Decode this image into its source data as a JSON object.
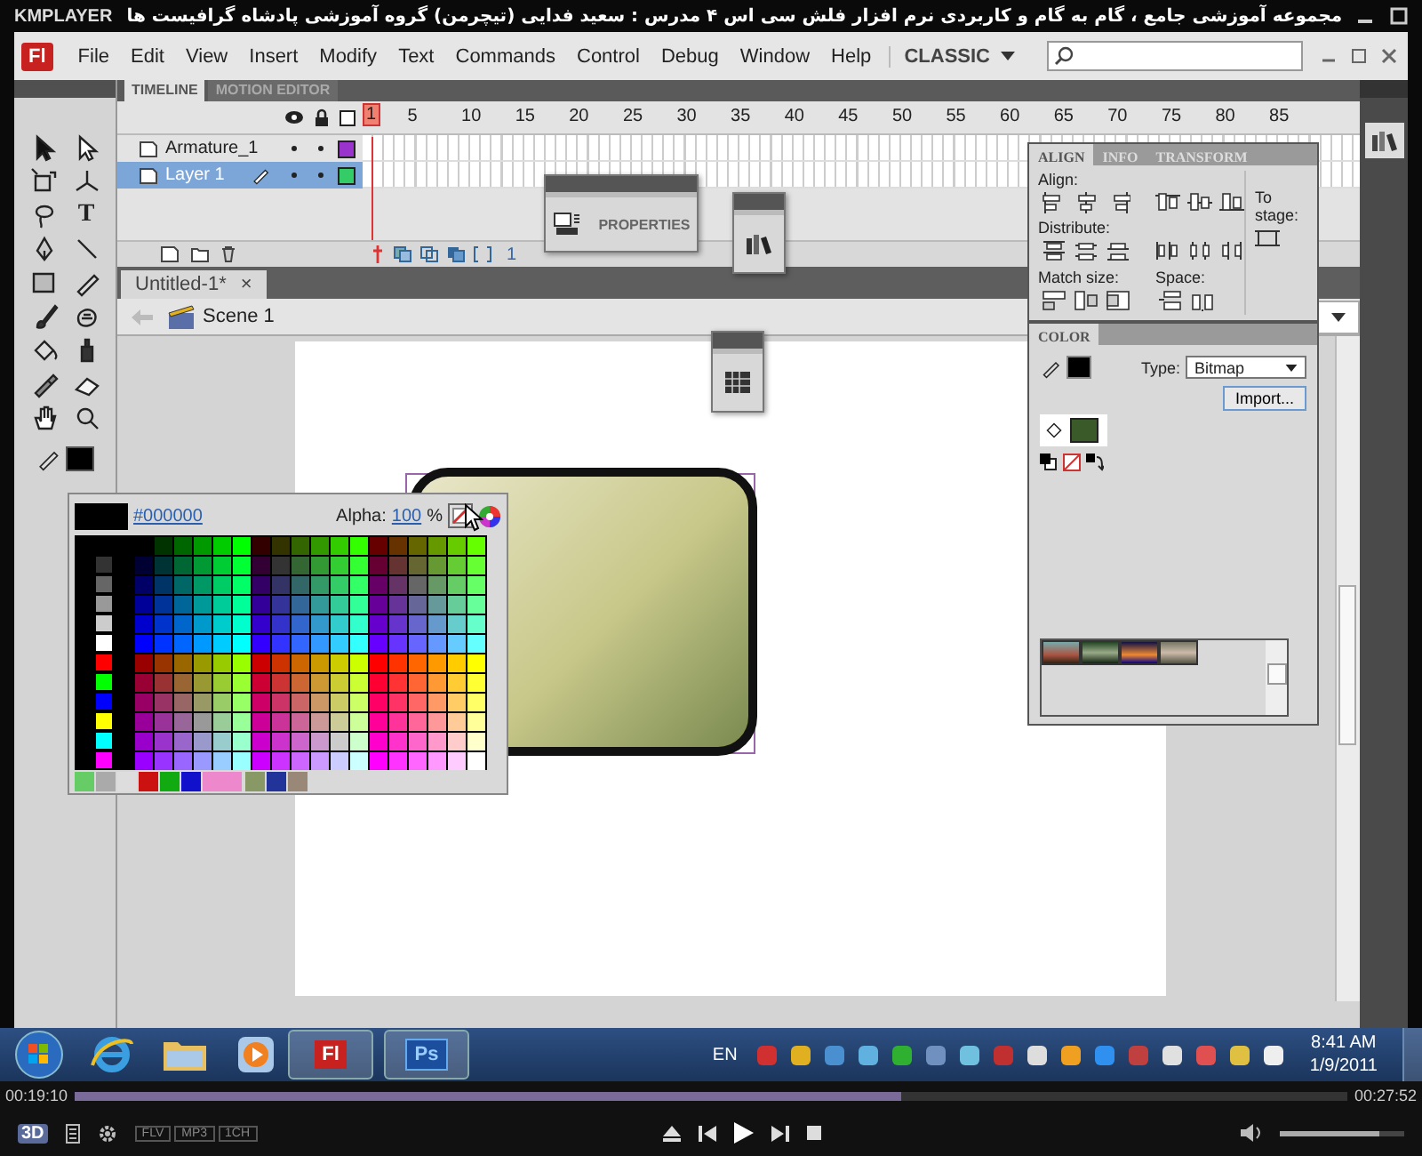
{
  "player": {
    "logo": "KMPLAYER",
    "title": "مجموعه آموزشی جامع ، گام به گام و کاربردی نرم افزار فلش سی اس ۴ مدرس : سعید فدایی (تیچرمن) گروه آموزشی پادشاه گرافیست ها"
  },
  "app": {
    "logo": "Fl",
    "menu": [
      "File",
      "Edit",
      "View",
      "Insert",
      "Modify",
      "Text",
      "Commands",
      "Control",
      "Debug",
      "Window",
      "Help"
    ],
    "workspace": "CLASSIC"
  },
  "tools": {
    "text_tool": "T"
  },
  "timeline": {
    "tabs": [
      {
        "label": "TIMELINE",
        "selected": true
      },
      {
        "label": "MOTION EDITOR",
        "selected": false
      }
    ],
    "frame_numbers": [
      "1",
      "5",
      "10",
      "15",
      "20",
      "25",
      "30",
      "35",
      "40",
      "45",
      "50",
      "55",
      "60",
      "65",
      "70",
      "75",
      "80",
      "85"
    ],
    "layers": [
      {
        "name": "Armature_1",
        "selected": false,
        "color": "#9933cc"
      },
      {
        "name": "Layer 1",
        "selected": true,
        "color": "#33cc66"
      }
    ],
    "current_frame": "1"
  },
  "floating_panels": [
    {
      "kind": "properties",
      "label": "PROPERTIES"
    },
    {
      "kind": "library"
    },
    {
      "kind": "swatches"
    }
  ],
  "document": {
    "tab": "Untitled-1*",
    "close": "×",
    "scene": "Scene 1"
  },
  "color_popup": {
    "hex": "#000000",
    "alpha_label": "Alpha:",
    "alpha": "100",
    "percent": "%"
  },
  "align_panel": {
    "tabs": [
      {
        "label": "ALIGN",
        "selected": true
      },
      {
        "label": "INFO",
        "selected": false
      },
      {
        "label": "TRANSFORM",
        "selected": false
      }
    ],
    "align": "Align:",
    "distribute": "Distribute:",
    "match_size": "Match size:",
    "space": "Space:",
    "to_stage": "To stage:"
  },
  "color_panel": {
    "title": "COLOR",
    "type_label": "Type:",
    "type": "Bitmap",
    "import": "Import..."
  },
  "taskbar": {
    "apps": [
      {
        "kind": "ie"
      },
      {
        "kind": "explorer"
      },
      {
        "kind": "media"
      },
      {
        "kind": "flash",
        "label": "Fl"
      },
      {
        "kind": "photoshop",
        "label": "Ps"
      }
    ],
    "language": "EN",
    "time": "8:41 AM",
    "date": "1/9/2011"
  },
  "playback": {
    "elapsed": "00:19:10",
    "total": "00:27:52",
    "level": 0.65,
    "mode": "3D",
    "badges": [
      "FLV",
      "MP3",
      "1CH"
    ],
    "volume": {
      "level": 0.8
    }
  }
}
